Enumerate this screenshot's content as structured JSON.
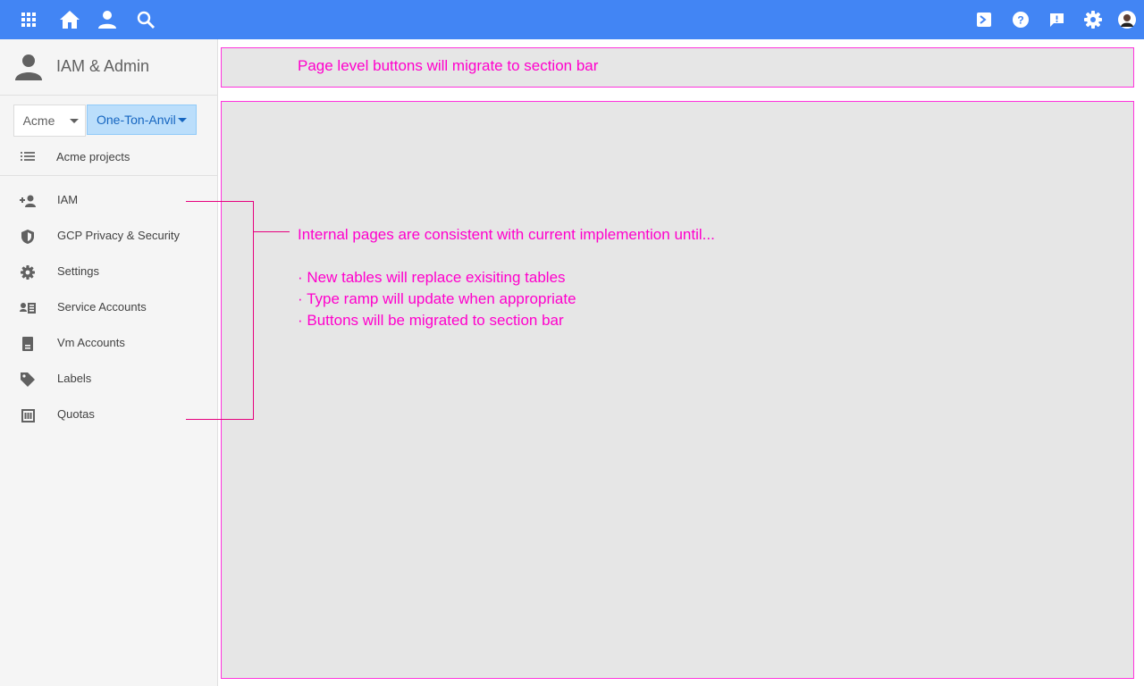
{
  "topbar": {
    "icons": [
      "apps-icon",
      "home-icon",
      "person-icon",
      "search-icon",
      "cloud-shell-icon",
      "help-icon",
      "feedback-icon",
      "settings-icon",
      "account-avatar-icon"
    ]
  },
  "sidebar": {
    "title": "IAM & Admin",
    "org_selector": "Acme",
    "project_selector": "One-Ton-Anvil",
    "projects_link": "Acme projects",
    "items": [
      {
        "label": "IAM",
        "icon": "person-add-icon"
      },
      {
        "label": "GCP Privacy & Security",
        "icon": "shield-icon"
      },
      {
        "label": "Settings",
        "icon": "gear-icon"
      },
      {
        "label": "Service Accounts",
        "icon": "service-account-icon"
      },
      {
        "label": "Vm Accounts",
        "icon": "vm-account-icon"
      },
      {
        "label": "Labels",
        "icon": "tag-icon"
      },
      {
        "label": "Quotas",
        "icon": "quota-icon"
      }
    ]
  },
  "annotations": {
    "section_bar_note": "Page level buttons will migrate to section bar",
    "internal_note": "Internal pages are consistent with current implemention until...",
    "bullets": [
      "· New tables will replace exisiting tables",
      "· Type ramp will update when appropriate",
      "· Buttons will be migrated to section bar"
    ]
  },
  "colors": {
    "topbar": "#4285f4",
    "annotation": "#ff00cc",
    "placeholder_fill": "#e6e6e6",
    "project_selected": "#bbdefb"
  }
}
